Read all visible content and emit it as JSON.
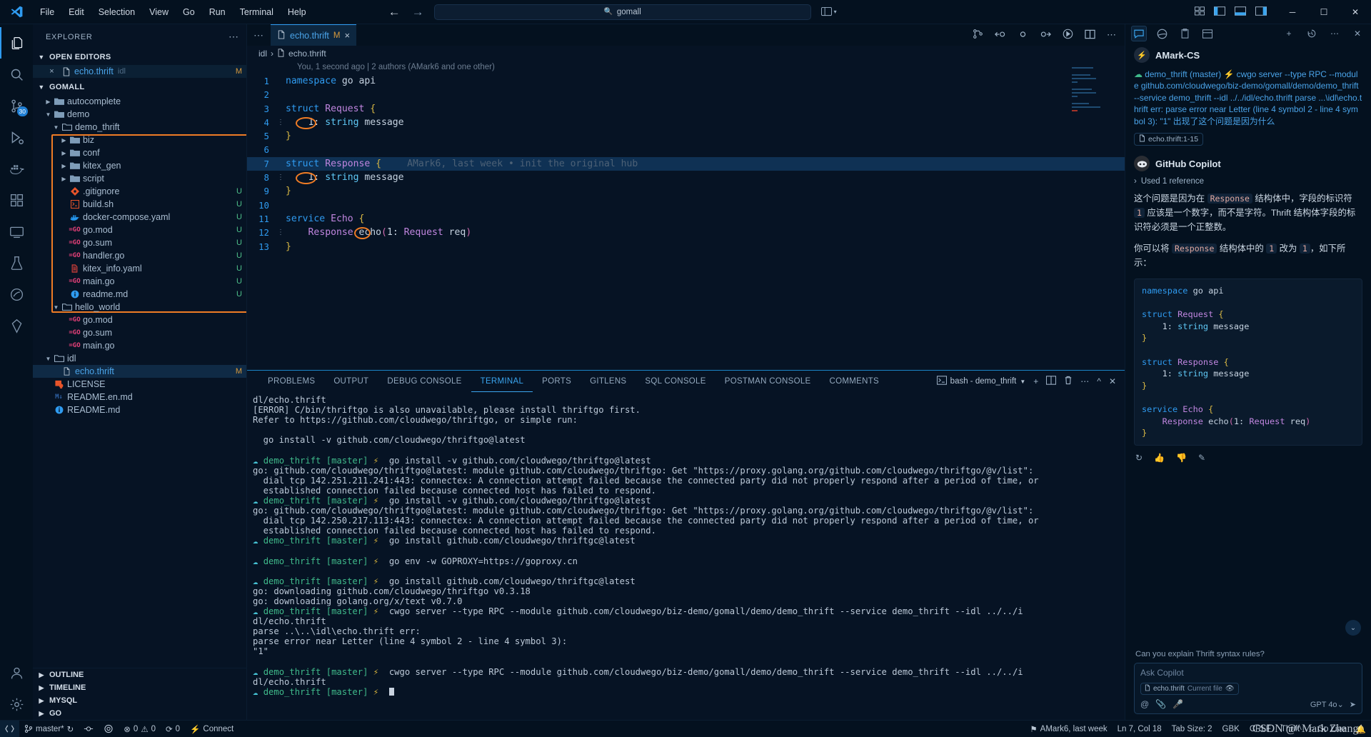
{
  "titlebar": {
    "menu": [
      "File",
      "Edit",
      "Selection",
      "View",
      "Go",
      "Run",
      "Terminal",
      "Help"
    ],
    "search_value": "gomall",
    "search_icon": "search-icon",
    "back_icon": "←",
    "forward_icon": "→"
  },
  "activitybar": {
    "items": [
      {
        "name": "explorer",
        "icon": "files-icon"
      },
      {
        "name": "search",
        "icon": "search-icon"
      },
      {
        "name": "source-control",
        "icon": "source-control-icon",
        "badge": "30"
      },
      {
        "name": "run-debug",
        "icon": "run-debug-icon"
      },
      {
        "name": "docker",
        "icon": "docker-icon"
      },
      {
        "name": "extensions",
        "icon": "extensions-icon"
      },
      {
        "name": "remote-explorer",
        "icon": "remote-explorer-icon"
      },
      {
        "name": "testing",
        "icon": "beaker-icon"
      },
      {
        "name": "kite",
        "icon": "kite-icon"
      },
      {
        "name": "database",
        "icon": "database-icon"
      },
      {
        "name": "postman",
        "icon": "postman-icon"
      }
    ],
    "bottom": [
      {
        "name": "accounts",
        "icon": "account-icon"
      },
      {
        "name": "settings",
        "icon": "gear-icon"
      }
    ]
  },
  "sidebar": {
    "title": "EXPLORER",
    "more_icon": "⋯",
    "open_editors": {
      "label": "OPEN EDITORS",
      "items": [
        {
          "name": "echo.thrift",
          "suffix": "idl",
          "badge": "M",
          "close_icon": "×"
        }
      ]
    },
    "workspace": {
      "label": "GOMALL",
      "items": [
        {
          "label": "autocomplete",
          "type": "folder",
          "depth": 1,
          "expanded": false,
          "icon": "folder-icon"
        },
        {
          "label": "demo",
          "type": "folder",
          "depth": 1,
          "expanded": true,
          "icon": "folder-icon",
          "dot": true
        },
        {
          "label": "demo_thrift",
          "type": "folder",
          "depth": 2,
          "expanded": true,
          "icon": "folder-open-icon",
          "dot": true
        },
        {
          "label": "biz",
          "type": "folder",
          "depth": 3,
          "expanded": false,
          "icon": "folder-icon",
          "dot": true
        },
        {
          "label": "conf",
          "type": "folder",
          "depth": 3,
          "expanded": false,
          "icon": "folder-icon",
          "dot": true
        },
        {
          "label": "kitex_gen",
          "type": "folder",
          "depth": 3,
          "expanded": false,
          "icon": "folder-icon",
          "dot": true
        },
        {
          "label": "script",
          "type": "folder",
          "depth": 3,
          "expanded": false,
          "icon": "folder-icon",
          "dot": true
        },
        {
          "label": ".gitignore",
          "type": "file",
          "depth": 3,
          "icon": "git-icon",
          "badge": "U"
        },
        {
          "label": "build.sh",
          "type": "file",
          "depth": 3,
          "icon": "shell-icon",
          "badge": "U"
        },
        {
          "label": "docker-compose.yaml",
          "type": "file",
          "depth": 3,
          "icon": "docker-icon",
          "badge": "U"
        },
        {
          "label": "go.mod",
          "type": "file",
          "depth": 3,
          "icon": "go-icon",
          "badge": "U"
        },
        {
          "label": "go.sum",
          "type": "file",
          "depth": 3,
          "icon": "go-icon",
          "badge": "U"
        },
        {
          "label": "handler.go",
          "type": "file",
          "depth": 3,
          "icon": "go-icon",
          "badge": "U"
        },
        {
          "label": "kitex_info.yaml",
          "type": "file",
          "depth": 3,
          "icon": "yaml-icon",
          "badge": "U"
        },
        {
          "label": "main.go",
          "type": "file",
          "depth": 3,
          "icon": "go-icon",
          "badge": "U"
        },
        {
          "label": "readme.md",
          "type": "file",
          "depth": 3,
          "icon": "info-icon",
          "badge": "U"
        },
        {
          "label": "hello_world",
          "type": "folder",
          "depth": 2,
          "expanded": true,
          "icon": "folder-open-icon"
        },
        {
          "label": "go.mod",
          "type": "file",
          "depth": 3,
          "icon": "go-icon"
        },
        {
          "label": "go.sum",
          "type": "file",
          "depth": 3,
          "icon": "go-icon"
        },
        {
          "label": "main.go",
          "type": "file",
          "depth": 3,
          "icon": "go-icon"
        },
        {
          "label": "idl",
          "type": "folder",
          "depth": 1,
          "expanded": true,
          "icon": "folder-open-icon",
          "dot": true
        },
        {
          "label": "echo.thrift",
          "type": "file",
          "depth": 2,
          "icon": "file-icon",
          "badge": "M",
          "selected": true
        },
        {
          "label": "LICENSE",
          "type": "file",
          "depth": 1,
          "icon": "license-icon"
        },
        {
          "label": "README.en.md",
          "type": "file",
          "depth": 1,
          "icon": "md-icon"
        },
        {
          "label": "README.md",
          "type": "file",
          "depth": 1,
          "icon": "info-icon"
        }
      ]
    },
    "bottom_sections": [
      "OUTLINE",
      "TIMELINE",
      "MYSQL",
      "GO"
    ]
  },
  "editor": {
    "tab": {
      "label": "echo.thrift",
      "modified": "M",
      "close_icon": "×",
      "icon": "file-icon"
    },
    "breadcrumb": [
      "idl",
      "echo.thrift"
    ],
    "blame": "You, 1 second ago | 2 authors (AMark6 and one other)",
    "inline_blame_line7": "AMark6, last week • init the original hub",
    "toolbar_icons": [
      "compare-icon",
      "gitlens-revision-icon",
      "gitlens-previous-icon",
      "gitlens-current-icon",
      "gitlens-next-icon",
      "run-icon",
      "split-editor-icon",
      "more-actions-icon"
    ],
    "lines": [
      {
        "n": 1,
        "text": "namespace go api"
      },
      {
        "n": 2,
        "text": ""
      },
      {
        "n": 3,
        "text": "struct Request {"
      },
      {
        "n": 4,
        "text": "    1: string message"
      },
      {
        "n": 5,
        "text": "}"
      },
      {
        "n": 6,
        "text": ""
      },
      {
        "n": 7,
        "text": "struct Response {",
        "highlighted": true
      },
      {
        "n": 8,
        "text": "    1: string message"
      },
      {
        "n": 9,
        "text": "}"
      },
      {
        "n": 10,
        "text": ""
      },
      {
        "n": 11,
        "text": "service Echo {"
      },
      {
        "n": 12,
        "text": "    Response echo(1: Request req)"
      },
      {
        "n": 13,
        "text": "}"
      }
    ]
  },
  "panel": {
    "tabs": [
      "PROBLEMS",
      "OUTPUT",
      "DEBUG CONSOLE",
      "TERMINAL",
      "PORTS",
      "GITLENS",
      "SQL CONSOLE",
      "POSTMAN CONSOLE",
      "COMMENTS"
    ],
    "active_tab": "TERMINAL",
    "terminal_selector": "bash - demo_thrift",
    "terminal_icon": "terminal-icon",
    "actions": [
      "new-terminal-icon",
      "split-terminal-icon",
      "kill-terminal-icon",
      "more-icon",
      "maximize-icon",
      "close-icon"
    ],
    "terminal_lines": [
      {
        "t": "dl/echo.thrift"
      },
      {
        "t": "[ERROR] C/bin/thriftgo is also unavailable, please install thriftgo first."
      },
      {
        "t": "Refer to https://github.com/cloudwego/thriftgo, or simple run:"
      },
      {
        "t": ""
      },
      {
        "t": "  go install -v github.com/cloudwego/thriftgo@latest"
      },
      {
        "t": ""
      },
      {
        "prompt": true,
        "branch": "demo_thrift [master]",
        "cmd": "go install -v github.com/cloudwego/thriftgo@latest"
      },
      {
        "t": "go: github.com/cloudwego/thriftgo@latest: module github.com/cloudwego/thriftgo: Get \"https://proxy.golang.org/github.com/cloudwego/thriftgo/@v/list\":"
      },
      {
        "t": "  dial tcp 142.251.211.241:443: connectex: A connection attempt failed because the connected party did not properly respond after a period of time, or"
      },
      {
        "t": "  established connection failed because connected host has failed to respond."
      },
      {
        "prompt": true,
        "branch": "demo_thrift [master]",
        "cmd": "go install -v github.com/cloudwego/thriftgo@latest"
      },
      {
        "t": "go: github.com/cloudwego/thriftgo@latest: module github.com/cloudwego/thriftgo: Get \"https://proxy.golang.org/github.com/cloudwego/thriftgo/@v/list\":"
      },
      {
        "t": "  dial tcp 142.250.217.113:443: connectex: A connection attempt failed because the connected party did not properly respond after a period of time, or"
      },
      {
        "t": "  established connection failed because connected host has failed to respond."
      },
      {
        "prompt": true,
        "branch": "demo_thrift [master]",
        "cmd": "go install github.com/cloudwego/thriftgc@latest"
      },
      {
        "t": ""
      },
      {
        "prompt": true,
        "branch": "demo_thrift [master]",
        "cmd": "go env -w GOPROXY=https://goproxy.cn"
      },
      {
        "t": ""
      },
      {
        "prompt": true,
        "branch": "demo_thrift [master]",
        "cmd": "go install github.com/cloudwego/thriftgc@latest"
      },
      {
        "t": "go: downloading github.com/cloudwego/thriftgo v0.3.18"
      },
      {
        "t": "go: downloading golang.org/x/text v0.7.0"
      },
      {
        "prompt": true,
        "branch": "demo_thrift [master]",
        "cmd": "cwgo server --type RPC --module github.com/cloudwego/biz-demo/gomall/demo/demo_thrift --service demo_thrift --idl ../../i"
      },
      {
        "t": "dl/echo.thrift"
      },
      {
        "t": "parse ..\\..\\idl\\echo.thrift err:"
      },
      {
        "t": "parse error near Letter (line 4 symbol 2 - line 4 symbol 3):"
      },
      {
        "t": "\"1\""
      },
      {
        "t": ""
      },
      {
        "prompt": true,
        "branch": "demo_thrift [master]",
        "cmd": "cwgo server --type RPC --module github.com/cloudwego/biz-demo/gomall/demo/demo_thrift --service demo_thrift --idl ../../i"
      },
      {
        "t": "dl/echo.thrift"
      },
      {
        "prompt": true,
        "branch": "demo_thrift [master]",
        "cmd": "",
        "cursor": true
      }
    ]
  },
  "copilot": {
    "tabs": [
      "chat-icon",
      "edge-icon",
      "clipboard-icon",
      "layout-icon"
    ],
    "actions": [
      "new-chat-icon",
      "history-icon",
      "more-icon",
      "close-icon"
    ],
    "user": {
      "name": "AMark-CS",
      "avatar_icon": "lightning-avatar",
      "message": "demo_thrift (master)  ⚡ cwgo server --type RPC --module github.com/cloudwego/biz-demo/gomall/demo/demo_thrift --service demo_thrift --idl ../../idl/echo.thrift parse ...\\idl\\echo.thrift err: parse error near Letter (line 4 symbol 2 - line 4 symbol 3): \"1\" 出现了这个问题是因为什么",
      "file_chip": "echo.thrift:1-15",
      "file_chip_icon": "file-icon"
    },
    "bot": {
      "name": "GitHub Copilot",
      "avatar_icon": "copilot-icon",
      "reference": "Used 1 reference",
      "reference_chevron": "›",
      "paragraph1_pre": "这个问题是因为在 ",
      "paragraph1_code1": "Response",
      "paragraph1_mid": " 结构体中，字段的标识符 ",
      "paragraph1_code2": "1",
      "paragraph1_post": " 应该是一个数字，而不是字符。Thrift 结构体字段的标识符必须是一个正整数。",
      "paragraph2_pre": "你可以将 ",
      "paragraph2_code1": "Response",
      "paragraph2_mid": " 结构体中的 ",
      "paragraph2_code2": "1",
      "paragraph2_mid2": " 改为 ",
      "paragraph2_code3": "1",
      "paragraph2_post": "，如下所示：",
      "codeblock_lines": [
        "namespace go api",
        "",
        "struct Request {",
        "    1: string message",
        "}",
        "",
        "struct Response {",
        "    1: string message",
        "}",
        "",
        "service Echo {",
        "    Response echo(1: Request req)",
        "}"
      ],
      "block_actions": [
        "regenerate-icon",
        "thumbs-up-icon",
        "thumbs-down-icon",
        "insert-icon"
      ]
    },
    "suggestion": "Can you explain Thrift syntax rules?",
    "input_placeholder": "Ask Copilot",
    "input_chip": "echo.thrift",
    "input_chip_suffix": "Current file",
    "input_chip_icon": "file-icon",
    "input_icons": [
      "mention-icon",
      "attach-icon",
      "mic-icon"
    ],
    "model": "GPT 4o",
    "model_chevron": "⌄",
    "send_icon": "send-icon",
    "scroll_down_icon": "⌄"
  },
  "statusbar": {
    "remote_icon": "remote-icon",
    "branch": "master*",
    "sync_icon": "↻",
    "gitlens_icon": "gitlens-icon",
    "radar_icon": "radar-icon",
    "errors": "0",
    "warnings": "0",
    "error_icon": "⊗",
    "warning_icon": "⚠",
    "ports": "0",
    "ports_icon": "⟳",
    "connect_icon": "⚡",
    "connect": "Connect",
    "blame": "AMark6, last week",
    "blame_icon": "⚑",
    "position": "Ln 7, Col 18",
    "tabsize": "Tab Size: 2",
    "encoding": "GBK",
    "eol": "CRLF",
    "language": "Thrift",
    "golive": "Go Live",
    "golive_icon": "○",
    "bell_icon": "🔔"
  },
  "watermark": "CSDN @^Mark Zhang^"
}
